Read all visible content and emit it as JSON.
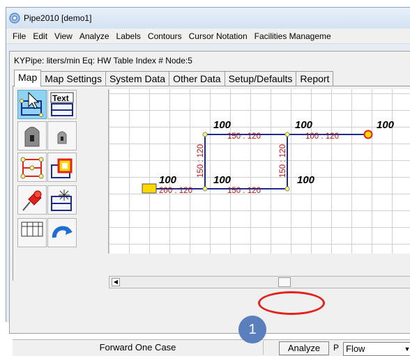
{
  "window": {
    "title": "Pipe2010  [demo1]"
  },
  "menu": [
    "File",
    "Edit",
    "View",
    "Analyze",
    "Labels",
    "Contours",
    "Cursor Notation",
    "Facilities Manageme"
  ],
  "info_line": "KYPipe: liters/min  Eq: HW  Table Index #  Node:5",
  "tabs": [
    "Map",
    "Map Settings",
    "System Data",
    "Other Data",
    "Setup/Defaults",
    "Report"
  ],
  "toolbox": {
    "text_tool_label": "Text"
  },
  "map": {
    "node_labels": [
      "100",
      "100",
      "100",
      "100",
      "100",
      "100"
    ],
    "pipe_labels": [
      "150 : 120",
      "100 : 120",
      "200 : 120",
      "150 : 120",
      "150 : 120",
      "150 : 120"
    ]
  },
  "statusbar": {
    "forward_label": "Forward One Case",
    "analyze_label": "Analyze",
    "p_label": "P",
    "flow_value": "Flow"
  },
  "callout": {
    "number": "1"
  },
  "colors": {
    "pipe": "#1a2b8c",
    "label_red": "#b01818",
    "node_fill": "#ffff66",
    "reservoir": "#ffd800",
    "highlight": "#e0241c",
    "callout_bg": "#5b7fbd"
  }
}
